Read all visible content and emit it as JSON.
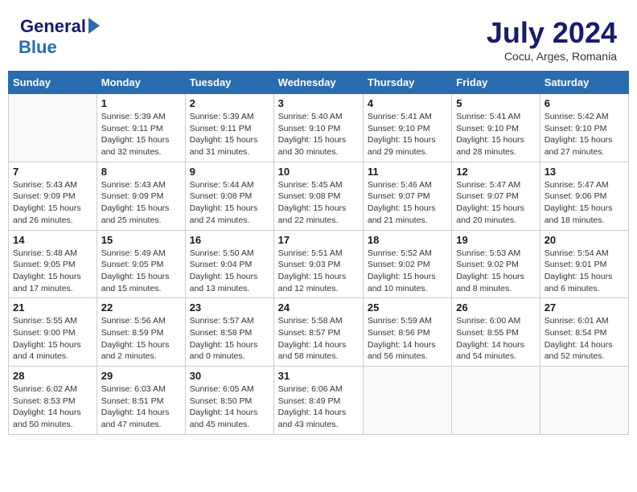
{
  "header": {
    "logo_general": "General",
    "logo_blue": "Blue",
    "title": "July 2024",
    "location": "Cocu, Arges, Romania"
  },
  "weekdays": [
    "Sunday",
    "Monday",
    "Tuesday",
    "Wednesday",
    "Thursday",
    "Friday",
    "Saturday"
  ],
  "weeks": [
    [
      {
        "day": "",
        "info": ""
      },
      {
        "day": "1",
        "info": "Sunrise: 5:39 AM\nSunset: 9:11 PM\nDaylight: 15 hours\nand 32 minutes."
      },
      {
        "day": "2",
        "info": "Sunrise: 5:39 AM\nSunset: 9:11 PM\nDaylight: 15 hours\nand 31 minutes."
      },
      {
        "day": "3",
        "info": "Sunrise: 5:40 AM\nSunset: 9:10 PM\nDaylight: 15 hours\nand 30 minutes."
      },
      {
        "day": "4",
        "info": "Sunrise: 5:41 AM\nSunset: 9:10 PM\nDaylight: 15 hours\nand 29 minutes."
      },
      {
        "day": "5",
        "info": "Sunrise: 5:41 AM\nSunset: 9:10 PM\nDaylight: 15 hours\nand 28 minutes."
      },
      {
        "day": "6",
        "info": "Sunrise: 5:42 AM\nSunset: 9:10 PM\nDaylight: 15 hours\nand 27 minutes."
      }
    ],
    [
      {
        "day": "7",
        "info": "Sunrise: 5:43 AM\nSunset: 9:09 PM\nDaylight: 15 hours\nand 26 minutes."
      },
      {
        "day": "8",
        "info": "Sunrise: 5:43 AM\nSunset: 9:09 PM\nDaylight: 15 hours\nand 25 minutes."
      },
      {
        "day": "9",
        "info": "Sunrise: 5:44 AM\nSunset: 9:08 PM\nDaylight: 15 hours\nand 24 minutes."
      },
      {
        "day": "10",
        "info": "Sunrise: 5:45 AM\nSunset: 9:08 PM\nDaylight: 15 hours\nand 22 minutes."
      },
      {
        "day": "11",
        "info": "Sunrise: 5:46 AM\nSunset: 9:07 PM\nDaylight: 15 hours\nand 21 minutes."
      },
      {
        "day": "12",
        "info": "Sunrise: 5:47 AM\nSunset: 9:07 PM\nDaylight: 15 hours\nand 20 minutes."
      },
      {
        "day": "13",
        "info": "Sunrise: 5:47 AM\nSunset: 9:06 PM\nDaylight: 15 hours\nand 18 minutes."
      }
    ],
    [
      {
        "day": "14",
        "info": "Sunrise: 5:48 AM\nSunset: 9:05 PM\nDaylight: 15 hours\nand 17 minutes."
      },
      {
        "day": "15",
        "info": "Sunrise: 5:49 AM\nSunset: 9:05 PM\nDaylight: 15 hours\nand 15 minutes."
      },
      {
        "day": "16",
        "info": "Sunrise: 5:50 AM\nSunset: 9:04 PM\nDaylight: 15 hours\nand 13 minutes."
      },
      {
        "day": "17",
        "info": "Sunrise: 5:51 AM\nSunset: 9:03 PM\nDaylight: 15 hours\nand 12 minutes."
      },
      {
        "day": "18",
        "info": "Sunrise: 5:52 AM\nSunset: 9:02 PM\nDaylight: 15 hours\nand 10 minutes."
      },
      {
        "day": "19",
        "info": "Sunrise: 5:53 AM\nSunset: 9:02 PM\nDaylight: 15 hours\nand 8 minutes."
      },
      {
        "day": "20",
        "info": "Sunrise: 5:54 AM\nSunset: 9:01 PM\nDaylight: 15 hours\nand 6 minutes."
      }
    ],
    [
      {
        "day": "21",
        "info": "Sunrise: 5:55 AM\nSunset: 9:00 PM\nDaylight: 15 hours\nand 4 minutes."
      },
      {
        "day": "22",
        "info": "Sunrise: 5:56 AM\nSunset: 8:59 PM\nDaylight: 15 hours\nand 2 minutes."
      },
      {
        "day": "23",
        "info": "Sunrise: 5:57 AM\nSunset: 8:58 PM\nDaylight: 15 hours\nand 0 minutes."
      },
      {
        "day": "24",
        "info": "Sunrise: 5:58 AM\nSunset: 8:57 PM\nDaylight: 14 hours\nand 58 minutes."
      },
      {
        "day": "25",
        "info": "Sunrise: 5:59 AM\nSunset: 8:56 PM\nDaylight: 14 hours\nand 56 minutes."
      },
      {
        "day": "26",
        "info": "Sunrise: 6:00 AM\nSunset: 8:55 PM\nDaylight: 14 hours\nand 54 minutes."
      },
      {
        "day": "27",
        "info": "Sunrise: 6:01 AM\nSunset: 8:54 PM\nDaylight: 14 hours\nand 52 minutes."
      }
    ],
    [
      {
        "day": "28",
        "info": "Sunrise: 6:02 AM\nSunset: 8:53 PM\nDaylight: 14 hours\nand 50 minutes."
      },
      {
        "day": "29",
        "info": "Sunrise: 6:03 AM\nSunset: 8:51 PM\nDaylight: 14 hours\nand 47 minutes."
      },
      {
        "day": "30",
        "info": "Sunrise: 6:05 AM\nSunset: 8:50 PM\nDaylight: 14 hours\nand 45 minutes."
      },
      {
        "day": "31",
        "info": "Sunrise: 6:06 AM\nSunset: 8:49 PM\nDaylight: 14 hours\nand 43 minutes."
      },
      {
        "day": "",
        "info": ""
      },
      {
        "day": "",
        "info": ""
      },
      {
        "day": "",
        "info": ""
      }
    ]
  ]
}
